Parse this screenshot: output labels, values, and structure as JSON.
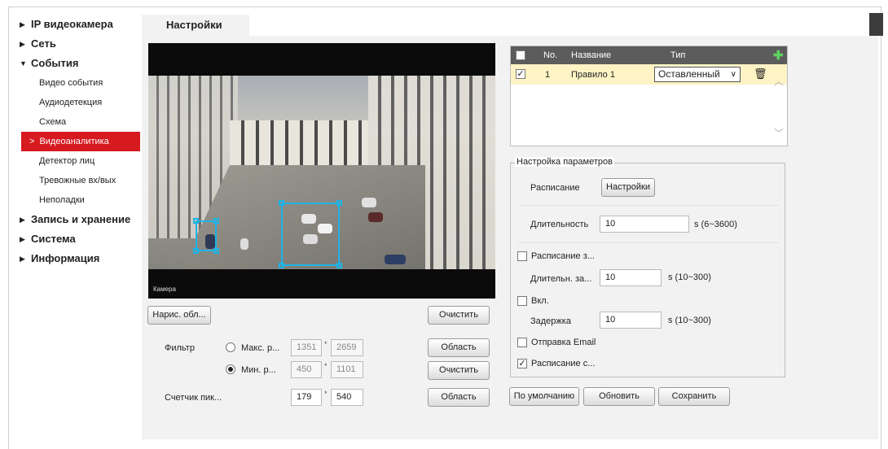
{
  "sidebar": {
    "items": [
      {
        "label": "IP видеокамера",
        "expanded": false
      },
      {
        "label": "Сеть",
        "expanded": false
      },
      {
        "label": "События",
        "expanded": true
      },
      {
        "label": "Запись и хранение",
        "expanded": false
      },
      {
        "label": "Система",
        "expanded": false
      },
      {
        "label": "Информация",
        "expanded": false
      }
    ],
    "sub_items": [
      "Видео события",
      "Аудиодетекция",
      "Схема",
      "Видеоаналитика",
      "Детектор лиц",
      "Тревожные вх/вых",
      "Неполадки"
    ],
    "active_sub": "Видеоаналитика"
  },
  "tabs": [
    {
      "label": "Настройки"
    }
  ],
  "video": {
    "overlay_label": "Камера"
  },
  "controls": {
    "draw_area_label": "Нарис. обл...",
    "clear1_label": "Очистить",
    "filter_label": "Фильтр",
    "max_label": "Макс. р...",
    "max_w": "1351",
    "max_h": "2659",
    "min_label": "Мин. р...",
    "min_w": "450",
    "min_h": "1101",
    "area1_label": "Область",
    "clear2_label": "Очистить",
    "counter_label": "Счетчик пик...",
    "counter_w": "179",
    "counter_h": "540",
    "area2_label": "Область",
    "times": "*"
  },
  "rules": {
    "headers": {
      "no": "No.",
      "name": "Название",
      "type": "Тип"
    },
    "rows": [
      {
        "no": "1",
        "name": "Правило 1",
        "type": "Оставленный"
      }
    ]
  },
  "params": {
    "title": "Настройка параметров",
    "schedule_label": "Расписание",
    "settings_button": "Настройки",
    "duration_label": "Длительность",
    "duration_value": "10",
    "duration_range": "s (6~3600)",
    "schedule_rec_label": "Расписание з...",
    "rec_duration_label": "Длительн. за...",
    "rec_duration_value": "10",
    "rec_duration_range": "s (10~300)",
    "enable_label": "Вкл.",
    "delay_label": "Задержка",
    "delay_value": "10",
    "delay_range": "s (10~300)",
    "email_label": "Отправка Email",
    "schedule_snap_label": "Расписание с...",
    "schedule_snap_checked": true
  },
  "footer": {
    "default_label": "По умолчанию",
    "refresh_label": "Обновить",
    "save_label": "Сохранить"
  },
  "colors": {
    "accent": "#d71920",
    "roi": "#1fb4e6",
    "row_highlight": "#fdf3c4",
    "header_bg": "#5c5c5c"
  }
}
